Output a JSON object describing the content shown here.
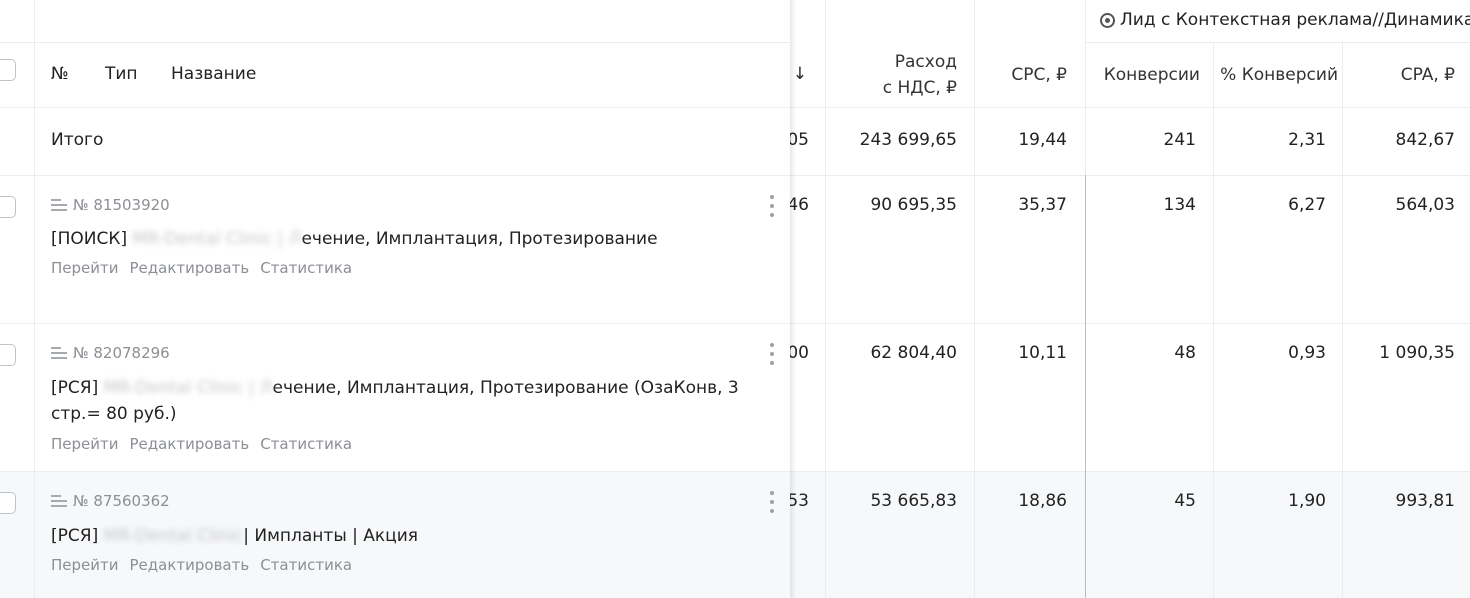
{
  "goal_header": "Лид с Контекстная реклама//Динамика",
  "columns": {
    "num": "№",
    "type": "Тип",
    "name": "Название",
    "sort_arrow": "↓",
    "expense_line1": "Расход",
    "expense_line2": "с НДС, ₽",
    "cpc": "CPC, ₽",
    "conversions": "Конверсии",
    "conv_rate": "% Конверсий",
    "cpa": "CPA, ₽"
  },
  "total": {
    "label": "Итого",
    "clipped": "05",
    "expense": "243 699,65",
    "cpc": "19,44",
    "conversions": "241",
    "conv_rate": "2,31",
    "cpa": "842,67"
  },
  "link_labels": {
    "go": "Перейти",
    "edit": "Редактировать",
    "stats": "Статистика"
  },
  "rows": [
    {
      "id": "№ 81503920",
      "name_prefix": "[ПОИСК] ",
      "name_blurred": "MR-Dental Clinic | Л",
      "name_rest": "ечение, Имплантация, Протезирование",
      "clipped": "46",
      "expense": "90 695,35",
      "cpc": "35,37",
      "conversions": "134",
      "conv_rate": "6,27",
      "cpa": "564,03"
    },
    {
      "id": "№ 82078296",
      "name_prefix": "[РСЯ] ",
      "name_blurred": "MR-Dental Clinic | Л",
      "name_rest": "ечение, Имплантация, Протезирование (ОзаКонв, 3 стр.= 80 руб.)",
      "clipped": "00",
      "expense": "62 804,40",
      "cpc": "10,11",
      "conversions": "48",
      "conv_rate": "0,93",
      "cpa": "1 090,35"
    },
    {
      "id": "№ 87560362",
      "name_prefix": "[РСЯ] ",
      "name_blurred": "MR-Dental Clinic ",
      "name_rest": "| Импланты | Акция",
      "clipped": "53",
      "expense": "53 665,83",
      "cpc": "18,86",
      "conversions": "45",
      "conv_rate": "1,90",
      "cpa": "993,81"
    }
  ],
  "colors": {
    "grid": "#ececec",
    "muted": "#8c8f94",
    "highlight_row": "#f7f8fa"
  }
}
